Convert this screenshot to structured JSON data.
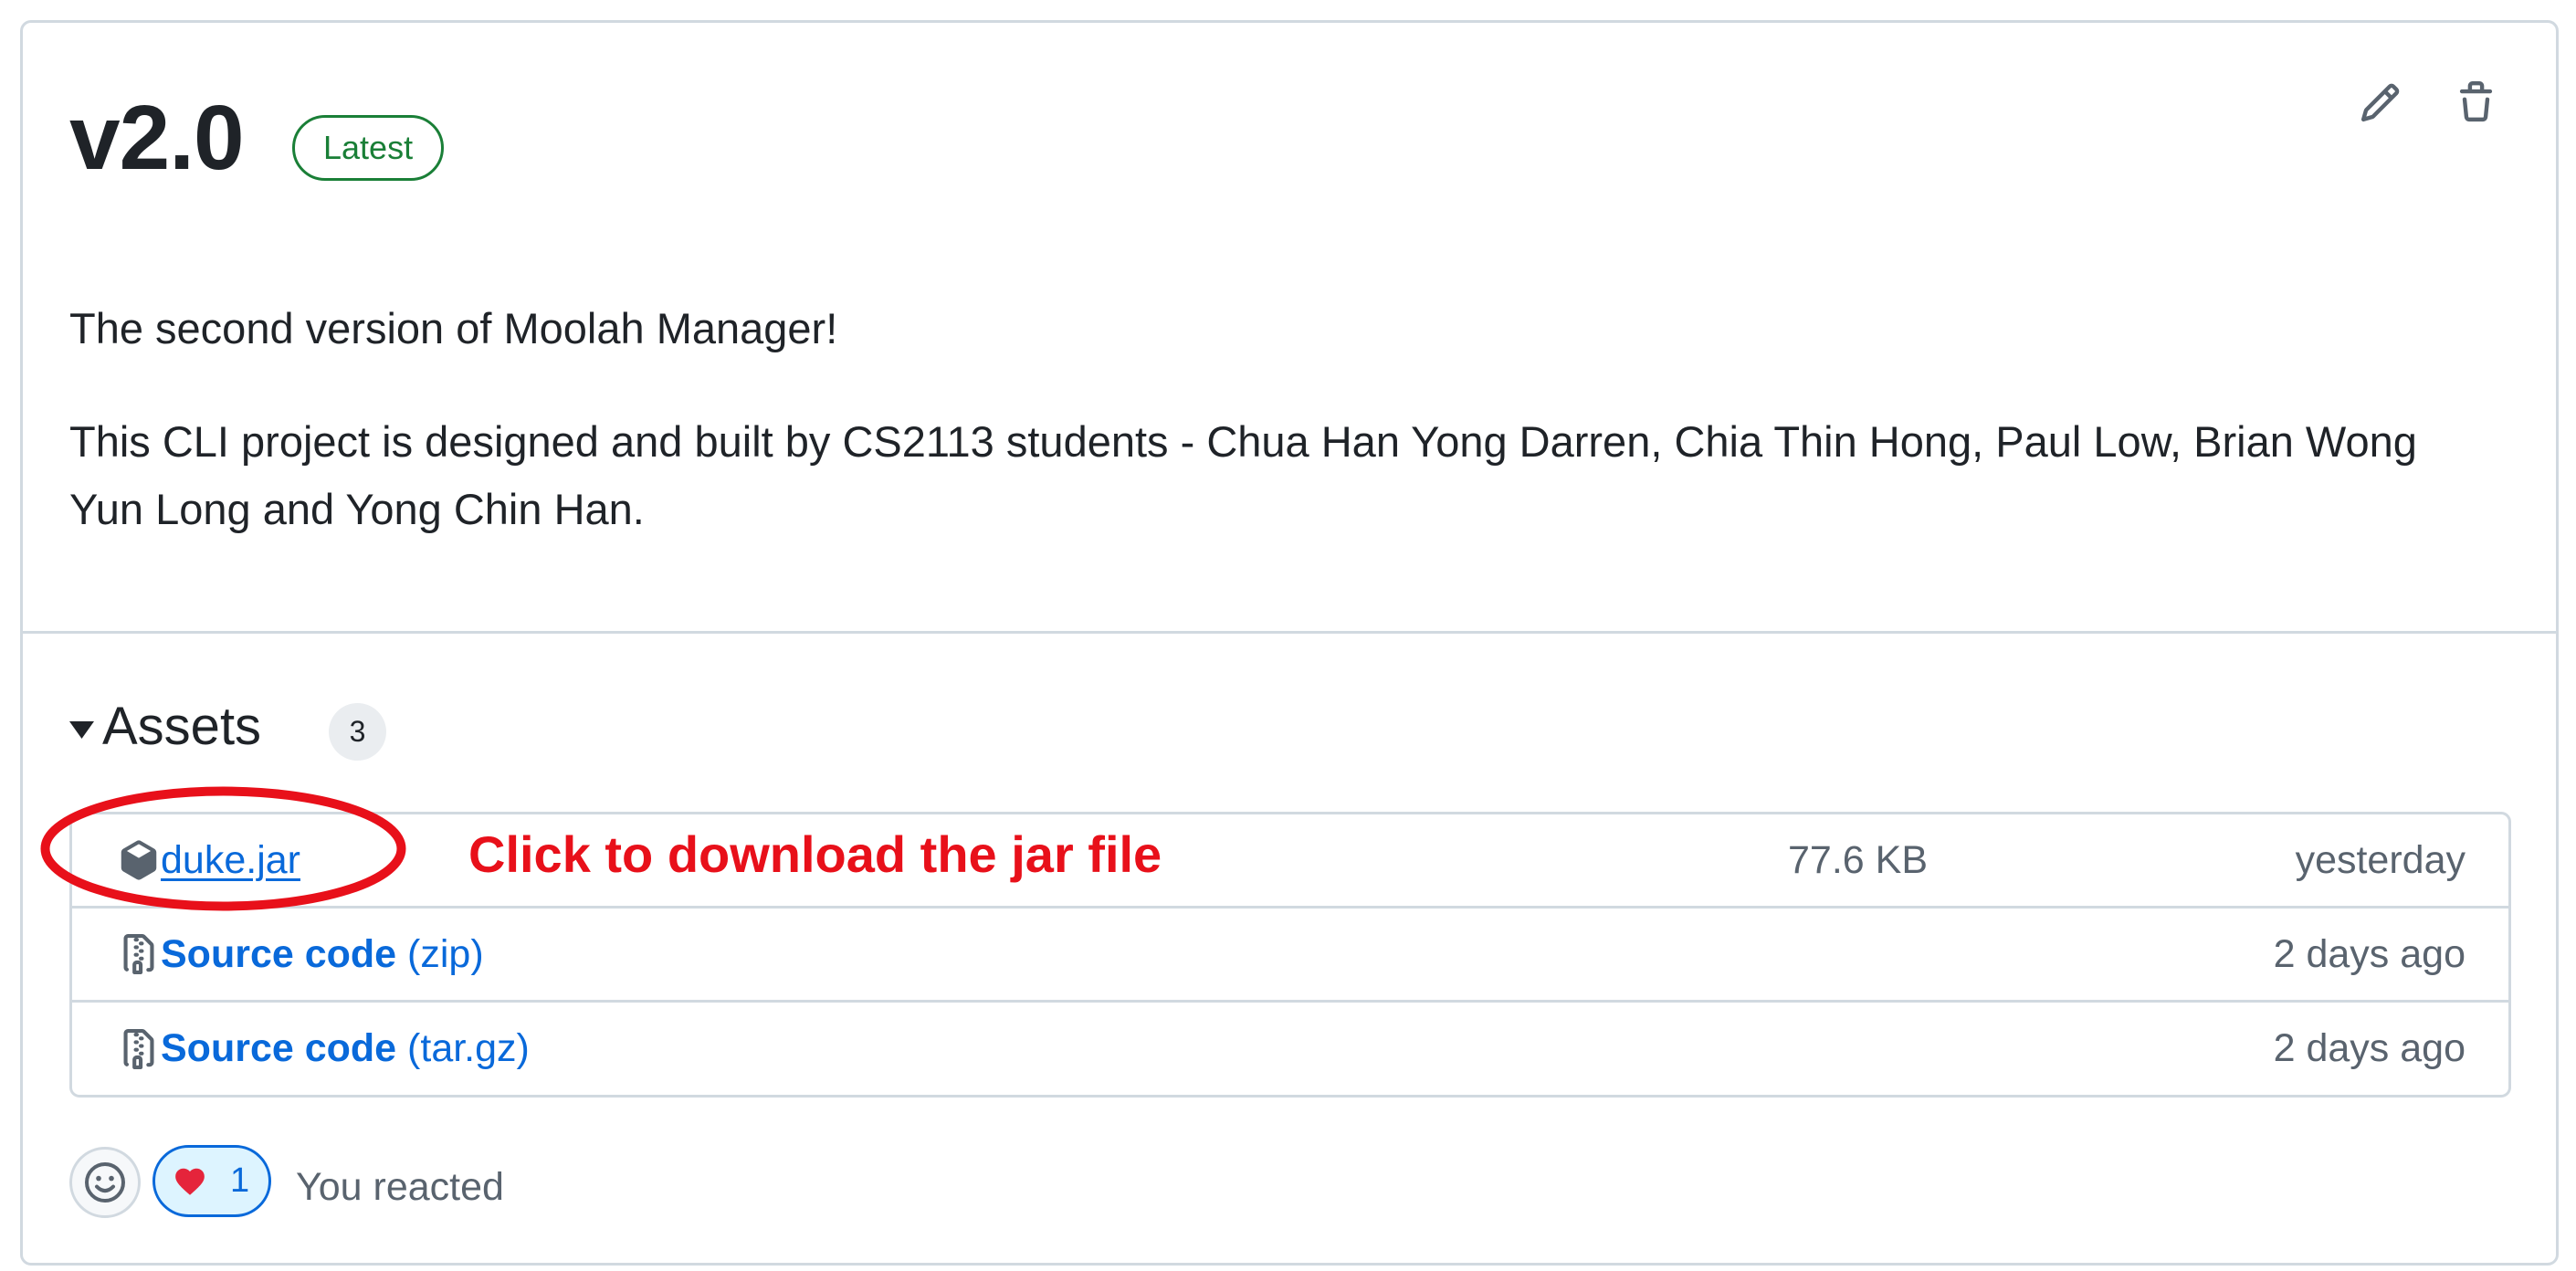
{
  "release": {
    "title": "v2.0",
    "badge": "Latest",
    "actions": {
      "edit_icon": "pencil-icon",
      "delete_icon": "trash-icon"
    },
    "description": [
      "The second version of Moolah Manager!",
      "This CLI project is designed and built by CS2113 students - Chua Han Yong Darren, Chia Thin Hong, Paul Low, Brian Wong Yun Long and Yong Chin Han."
    ]
  },
  "assets": {
    "heading": "Assets",
    "count": "3",
    "expanded": true,
    "items": [
      {
        "icon": "package-icon",
        "name": "duke.jar",
        "size": "77.6 KB",
        "date": "yesterday"
      },
      {
        "icon": "file-zip-icon",
        "name": "Source code",
        "suffix": "(zip)",
        "date": "2 days ago"
      },
      {
        "icon": "file-zip-icon",
        "name": "Source code",
        "suffix": "(tar.gz)",
        "date": "2 days ago"
      }
    ]
  },
  "annotation": {
    "text": "Click to download the jar file",
    "highlights": "duke.jar"
  },
  "reactions": {
    "add_icon": "smiley-icon",
    "items": [
      {
        "emoji": "heart",
        "count": "1",
        "reacted": true
      }
    ],
    "summary": "You reacted"
  },
  "colors": {
    "text": "#1f2328",
    "muted": "#59636e",
    "link": "#0969da",
    "border": "#d1d9e0",
    "latest_badge": "#1a7f37",
    "annotation": "#e8101a",
    "reaction_active_bg": "#ddf4ff"
  }
}
